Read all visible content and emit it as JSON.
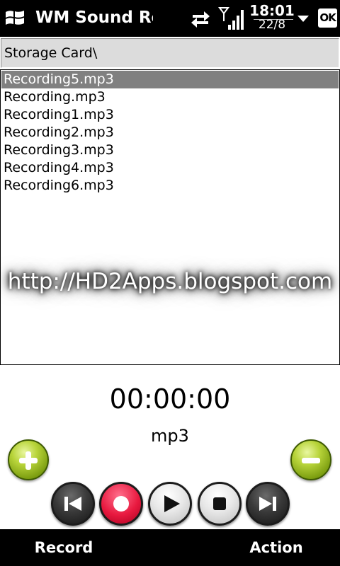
{
  "titlebar": {
    "app_title": "WM Sound Reco",
    "time": "18:01",
    "date": "22/8",
    "ok_label": "OK",
    "icons": [
      "windows-start-icon",
      "sync-arrows-icon",
      "signal-strength-icon",
      "dropdown-arrow-icon"
    ]
  },
  "path": {
    "text": "Storage Card\\"
  },
  "files": [
    {
      "name": "Recording5.mp3",
      "selected": true
    },
    {
      "name": "Recording.mp3",
      "selected": false
    },
    {
      "name": "Recording1.mp3",
      "selected": false
    },
    {
      "name": "Recording2.mp3",
      "selected": false
    },
    {
      "name": "Recording3.mp3",
      "selected": false
    },
    {
      "name": "Recording4.mp3",
      "selected": false
    },
    {
      "name": "Recording6.mp3",
      "selected": false
    }
  ],
  "watermark": "http://HD2Apps.blogspot.com",
  "player": {
    "timer": "00:00:00",
    "format": "mp3",
    "buttons": [
      "plus-icon",
      "minus-icon",
      "previous-icon",
      "record-icon",
      "play-icon",
      "stop-icon",
      "next-icon"
    ]
  },
  "softkeys": {
    "left": "Record",
    "right": "Action"
  },
  "colors": {
    "selection": "#808080",
    "bar_background": "#000000",
    "record_red": "#e8193f",
    "add_green": "#7c9e10"
  }
}
